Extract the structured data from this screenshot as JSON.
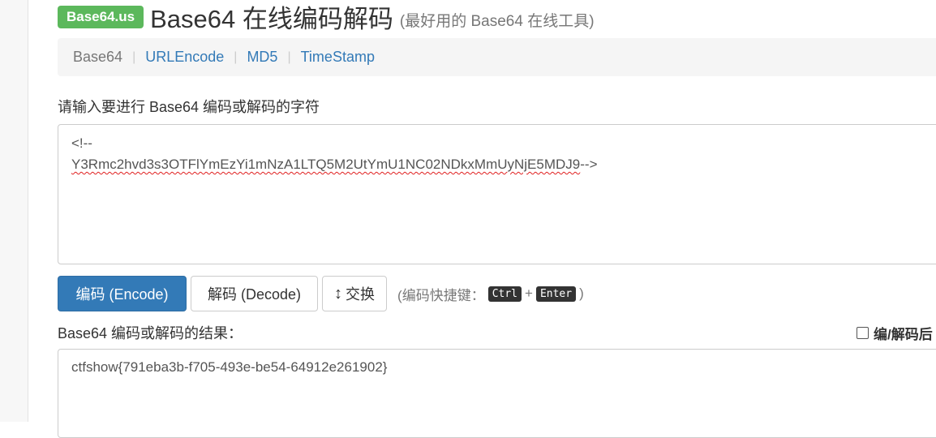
{
  "header": {
    "logo": "Base64.us",
    "title": "Base64 在线编码解码",
    "subtitle": "(最好用的 Base64 在线工具)"
  },
  "nav": {
    "items": [
      "Base64",
      "URLEncode",
      "MD5",
      "TimeStamp"
    ],
    "active": "Base64"
  },
  "input": {
    "label": "请输入要进行 Base64 编码或解码的字符",
    "line1": "<!--",
    "line2_encoded": "Y3Rmc2hvd3s3OTFlYmEzYi1mNzA1LTQ5M2UtYmU1NC02NDkxMmUyNjE5MDJ9",
    "line2_tail": "-->"
  },
  "buttons": {
    "encode": "编码 (Encode)",
    "decode": "解码 (Decode)",
    "swap_icon": "↕",
    "swap": "交换"
  },
  "hint": {
    "prefix": "(编码快捷键：",
    "key1": "Ctrl",
    "plus": "+",
    "key2": "Enter",
    "suffix": ")"
  },
  "result": {
    "label": "Base64 编码或解码的结果：",
    "auto_label": "编/解码后",
    "value": "ctfshow{791eba3b-f705-493e-be54-64912e261902}"
  },
  "colors": {
    "logo_bg": "#5cb85c",
    "primary": "#337ab7",
    "link": "#337ab7"
  }
}
